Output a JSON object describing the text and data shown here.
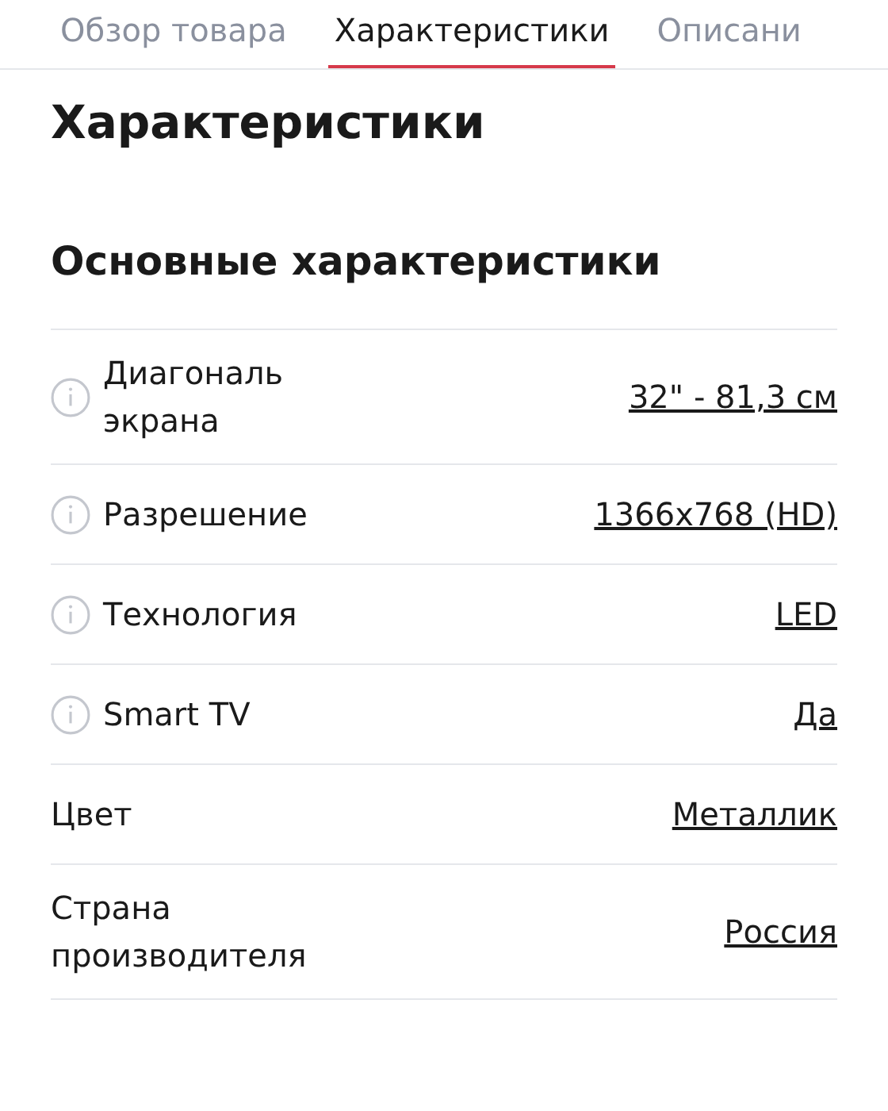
{
  "tabs": [
    {
      "label": "Обзор товара",
      "selected": false
    },
    {
      "label": "Характеристики",
      "selected": true
    },
    {
      "label": "Описани",
      "selected": false
    }
  ],
  "page_title": "Характеристики",
  "section": {
    "title": "Основные характеристики",
    "rows": [
      {
        "label": "Диагональ экрана",
        "value": "32\" - 81,3 см",
        "has_info": true
      },
      {
        "label": "Разрешение",
        "value": "1366x768 (HD)",
        "has_info": true
      },
      {
        "label": "Технология",
        "value": "LED",
        "has_info": true
      },
      {
        "label": "Smart TV",
        "value": "Да",
        "has_info": true
      },
      {
        "label": "Цвет",
        "value": "Металлик",
        "has_info": false
      },
      {
        "label": "Страна производителя",
        "value": "Россия",
        "has_info": false
      }
    ]
  }
}
